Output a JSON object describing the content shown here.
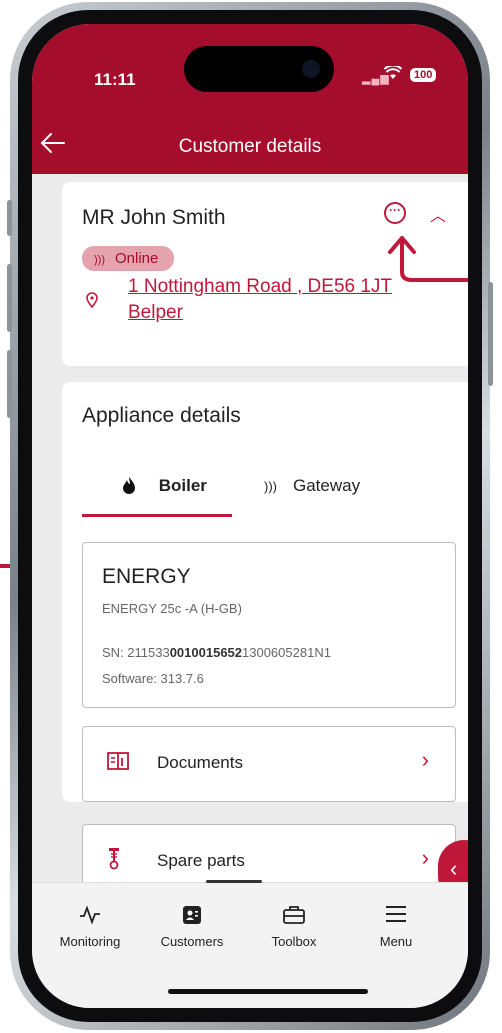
{
  "status_bar": {
    "time": "11:11",
    "battery": "100"
  },
  "app_bar": {
    "title": "Customer details",
    "back_icon": "arrow-left-icon"
  },
  "customer": {
    "name": "MR John Smith",
    "status": "Online",
    "address_line1": "1 Nottingham Road ,  DE56 1JT",
    "address_line2": "Belper"
  },
  "appliance": {
    "section_title": "Appliance details",
    "tabs": [
      {
        "label": "Boiler",
        "active": true
      },
      {
        "label": "Gateway",
        "active": false
      }
    ],
    "device": {
      "name": "ENERGY",
      "model": "ENERGY 25c -A (H-GB)",
      "sn_prefix": "SN: 211533",
      "sn_bold": "0010015652",
      "sn_suffix": "1300605281N1",
      "software": "Software: 313.7.6"
    },
    "rows": [
      {
        "label": "Documents"
      },
      {
        "label": "Spare parts"
      }
    ]
  },
  "bottom_nav": [
    {
      "label": "Monitoring"
    },
    {
      "label": "Customers"
    },
    {
      "label": "Toolbox"
    },
    {
      "label": "Menu"
    }
  ],
  "colors": {
    "brand": "#a50d2d",
    "accent": "#c0183a",
    "badge_bg": "#e5a3ae"
  }
}
